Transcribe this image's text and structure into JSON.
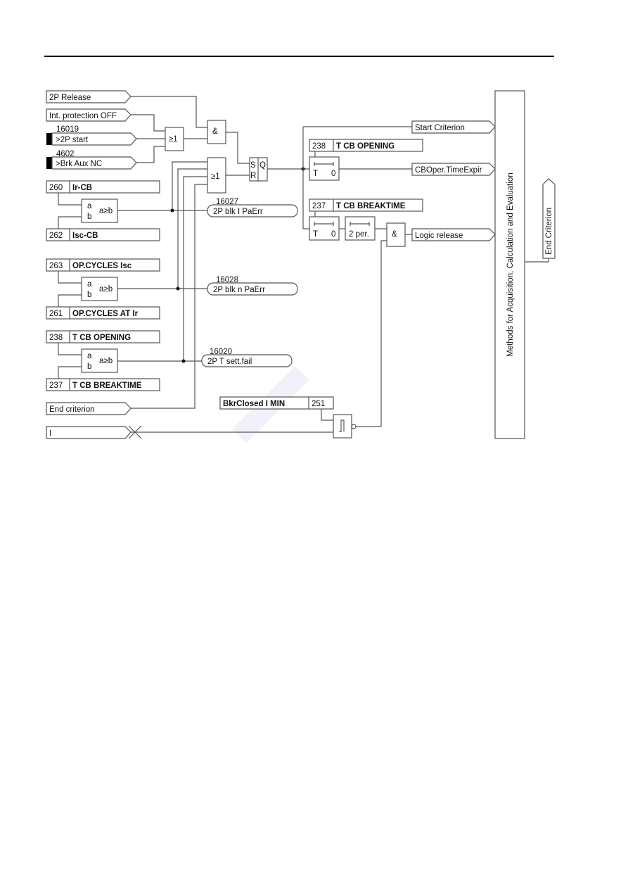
{
  "page": {
    "header_rule": true
  },
  "inputs": {
    "release": "2P Release",
    "int_prot_off": "Int. protection OFF",
    "start_num": "16019",
    "start": ">2P start",
    "brk_num": "4602",
    "brk": ">Brk Aux NC",
    "end_criterion_in": "End criterion",
    "current": "I"
  },
  "gates": {
    "or": "≥1",
    "and": "&",
    "s": "S",
    "r": "R",
    "q": "Q",
    "cmp_a": "a",
    "cmp_b": "b",
    "cmp_op": "a≥b"
  },
  "params": [
    {
      "num": "260",
      "name": "Ir-CB"
    },
    {
      "num": "262",
      "name": "Isc-CB"
    },
    {
      "num": "263",
      "name": "OP.CYCLES Isc"
    },
    {
      "num": "261",
      "name": "OP.CYCLES AT Ir"
    },
    {
      "num": "238",
      "name": "T CB OPENING"
    },
    {
      "num": "237",
      "name": "T CB BREAKTIME"
    }
  ],
  "timers": {
    "open_num": "238",
    "open_name": "T CB OPENING",
    "break_num": "237",
    "break_name": "T CB BREAKTIME",
    "t": "T",
    "zero": "0",
    "per": "2 per."
  },
  "messages": [
    {
      "num": "16027",
      "text": "2P blk I PaErr"
    },
    {
      "num": "16028",
      "text": "2P blk n PaErr"
    },
    {
      "num": "16020",
      "text": "2P T sett.fail"
    }
  ],
  "outputs": {
    "start_criterion": "Start Criterion",
    "cboper": "CBOper.TimeExpir",
    "logic_release": "Logic release",
    "end_criterion_out": "End Criterion"
  },
  "bkr": {
    "name": "BkrClosed I MIN",
    "num": "251"
  },
  "methods_box": "Methods for Acquisition, Calculation and Evaluation"
}
